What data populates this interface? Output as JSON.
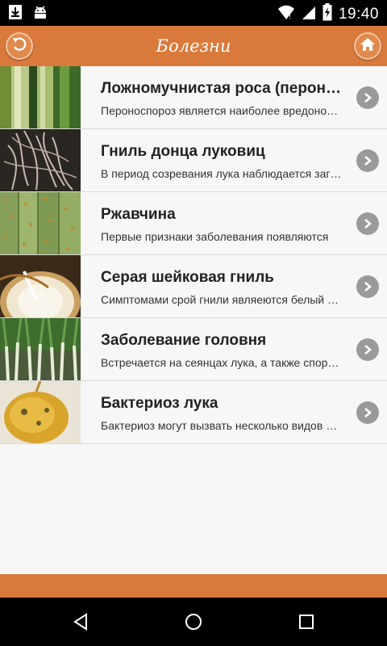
{
  "status_bar": {
    "time": "19:40",
    "icons": [
      "download-icon",
      "android-icon",
      "wifi-icon",
      "signal-icon",
      "battery-charging-icon"
    ]
  },
  "header": {
    "title": "Болезни",
    "back_icon": "back-arrow-icon",
    "home_icon": "home-icon"
  },
  "items": [
    {
      "title": "Ложномучнистая роса (пероноспороз)",
      "subtitle": "Пероноспороз является наиболее вредоносным",
      "thumb": "green onion leaves"
    },
    {
      "title": "Гниль донца луковиц",
      "subtitle": "В период созревания лука наблюдается загнивание",
      "thumb": "onion roots"
    },
    {
      "title": "Ржавчина",
      "subtitle": "Первые признаки заболевания появляются",
      "thumb": "rust spots on leaves"
    },
    {
      "title": "Серая шейковая гниль",
      "subtitle": "Симптомами срой гнили являеются белый налет",
      "thumb": "onion bulb cut"
    },
    {
      "title": "Заболевание головня",
      "subtitle": "Встречается на сеянцах лука, а также спорами",
      "thumb": "onion seedlings"
    },
    {
      "title": "Бактериоз лука",
      "subtitle": "Бактериоз могут вызвать несколько видов бактерий",
      "thumb": "yellow onion bulb"
    }
  ],
  "nav_bar": {
    "icons": [
      "nav-back-icon",
      "nav-home-icon",
      "nav-recents-icon"
    ]
  },
  "colors": {
    "accent": "#d97a3c",
    "chevron": "#9a9a9a",
    "list_bg": "#f7f7f7"
  }
}
